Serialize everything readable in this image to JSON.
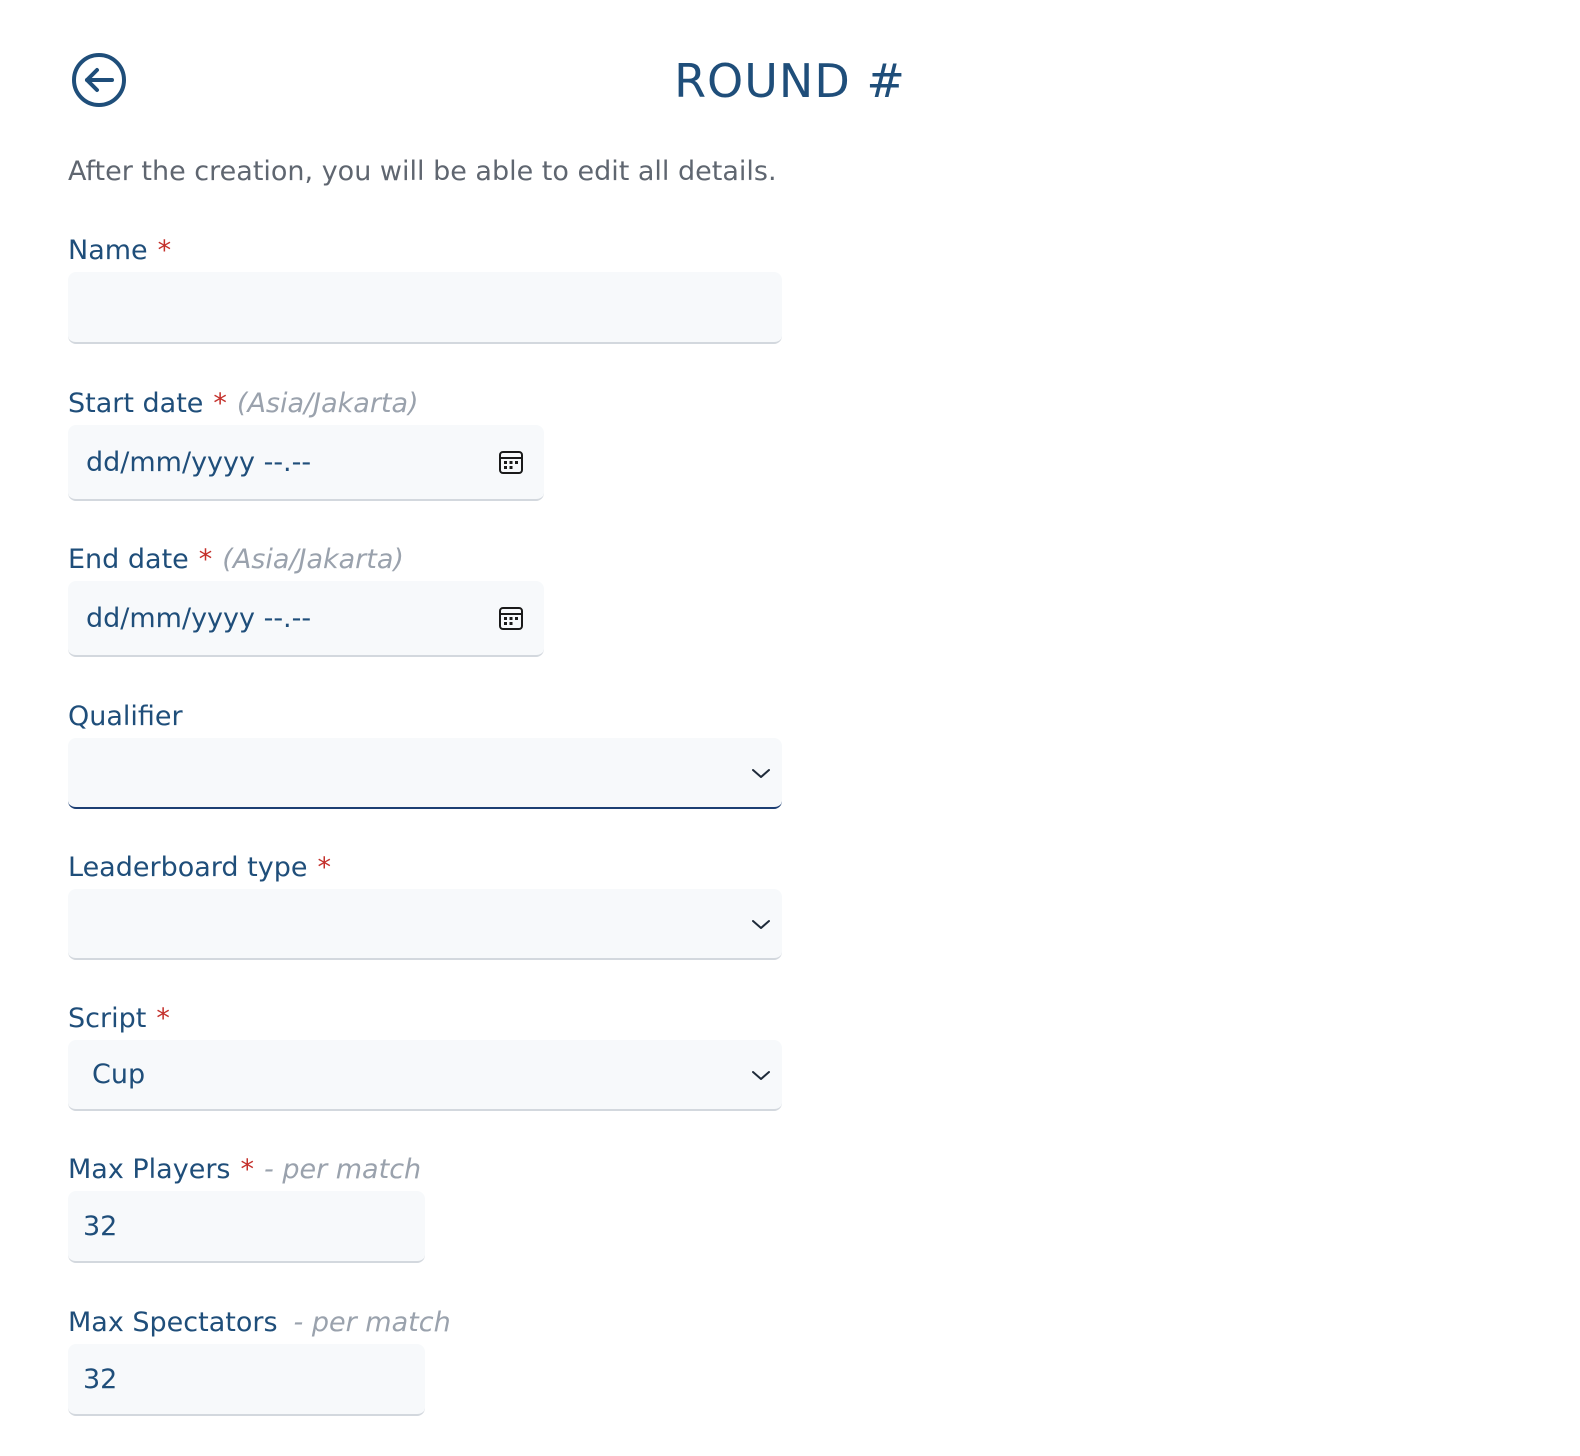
{
  "header": {
    "title": "ROUND #",
    "back_icon": "arrow-left-circle-icon"
  },
  "subtitle": "After the creation, you will be able to edit all details.",
  "required_mark": "*",
  "fields": {
    "name": {
      "label": "Name",
      "value": ""
    },
    "start_date": {
      "label": "Start date",
      "hint": "(Asia/Jakarta)",
      "value": "dd/mm/yyyy --.--"
    },
    "end_date": {
      "label": "End date",
      "hint": "(Asia/Jakarta)",
      "value": "dd/mm/yyyy --.--"
    },
    "qualifier": {
      "label": "Qualifier",
      "value": ""
    },
    "leaderboard_type": {
      "label": "Leaderboard type",
      "value": ""
    },
    "script": {
      "label": "Script",
      "value": "Cup"
    },
    "max_players": {
      "label": "Max Players",
      "hint": "- per match",
      "value": "32"
    },
    "max_spectators": {
      "label": "Max Spectators",
      "hint": "- per match",
      "value": "32"
    }
  },
  "colors": {
    "primary": "#1f4e7a",
    "required": "#c4302b",
    "hint": "#9aa2ad",
    "input_bg": "#f7f9fb",
    "focus_border": "#1d3f73"
  }
}
